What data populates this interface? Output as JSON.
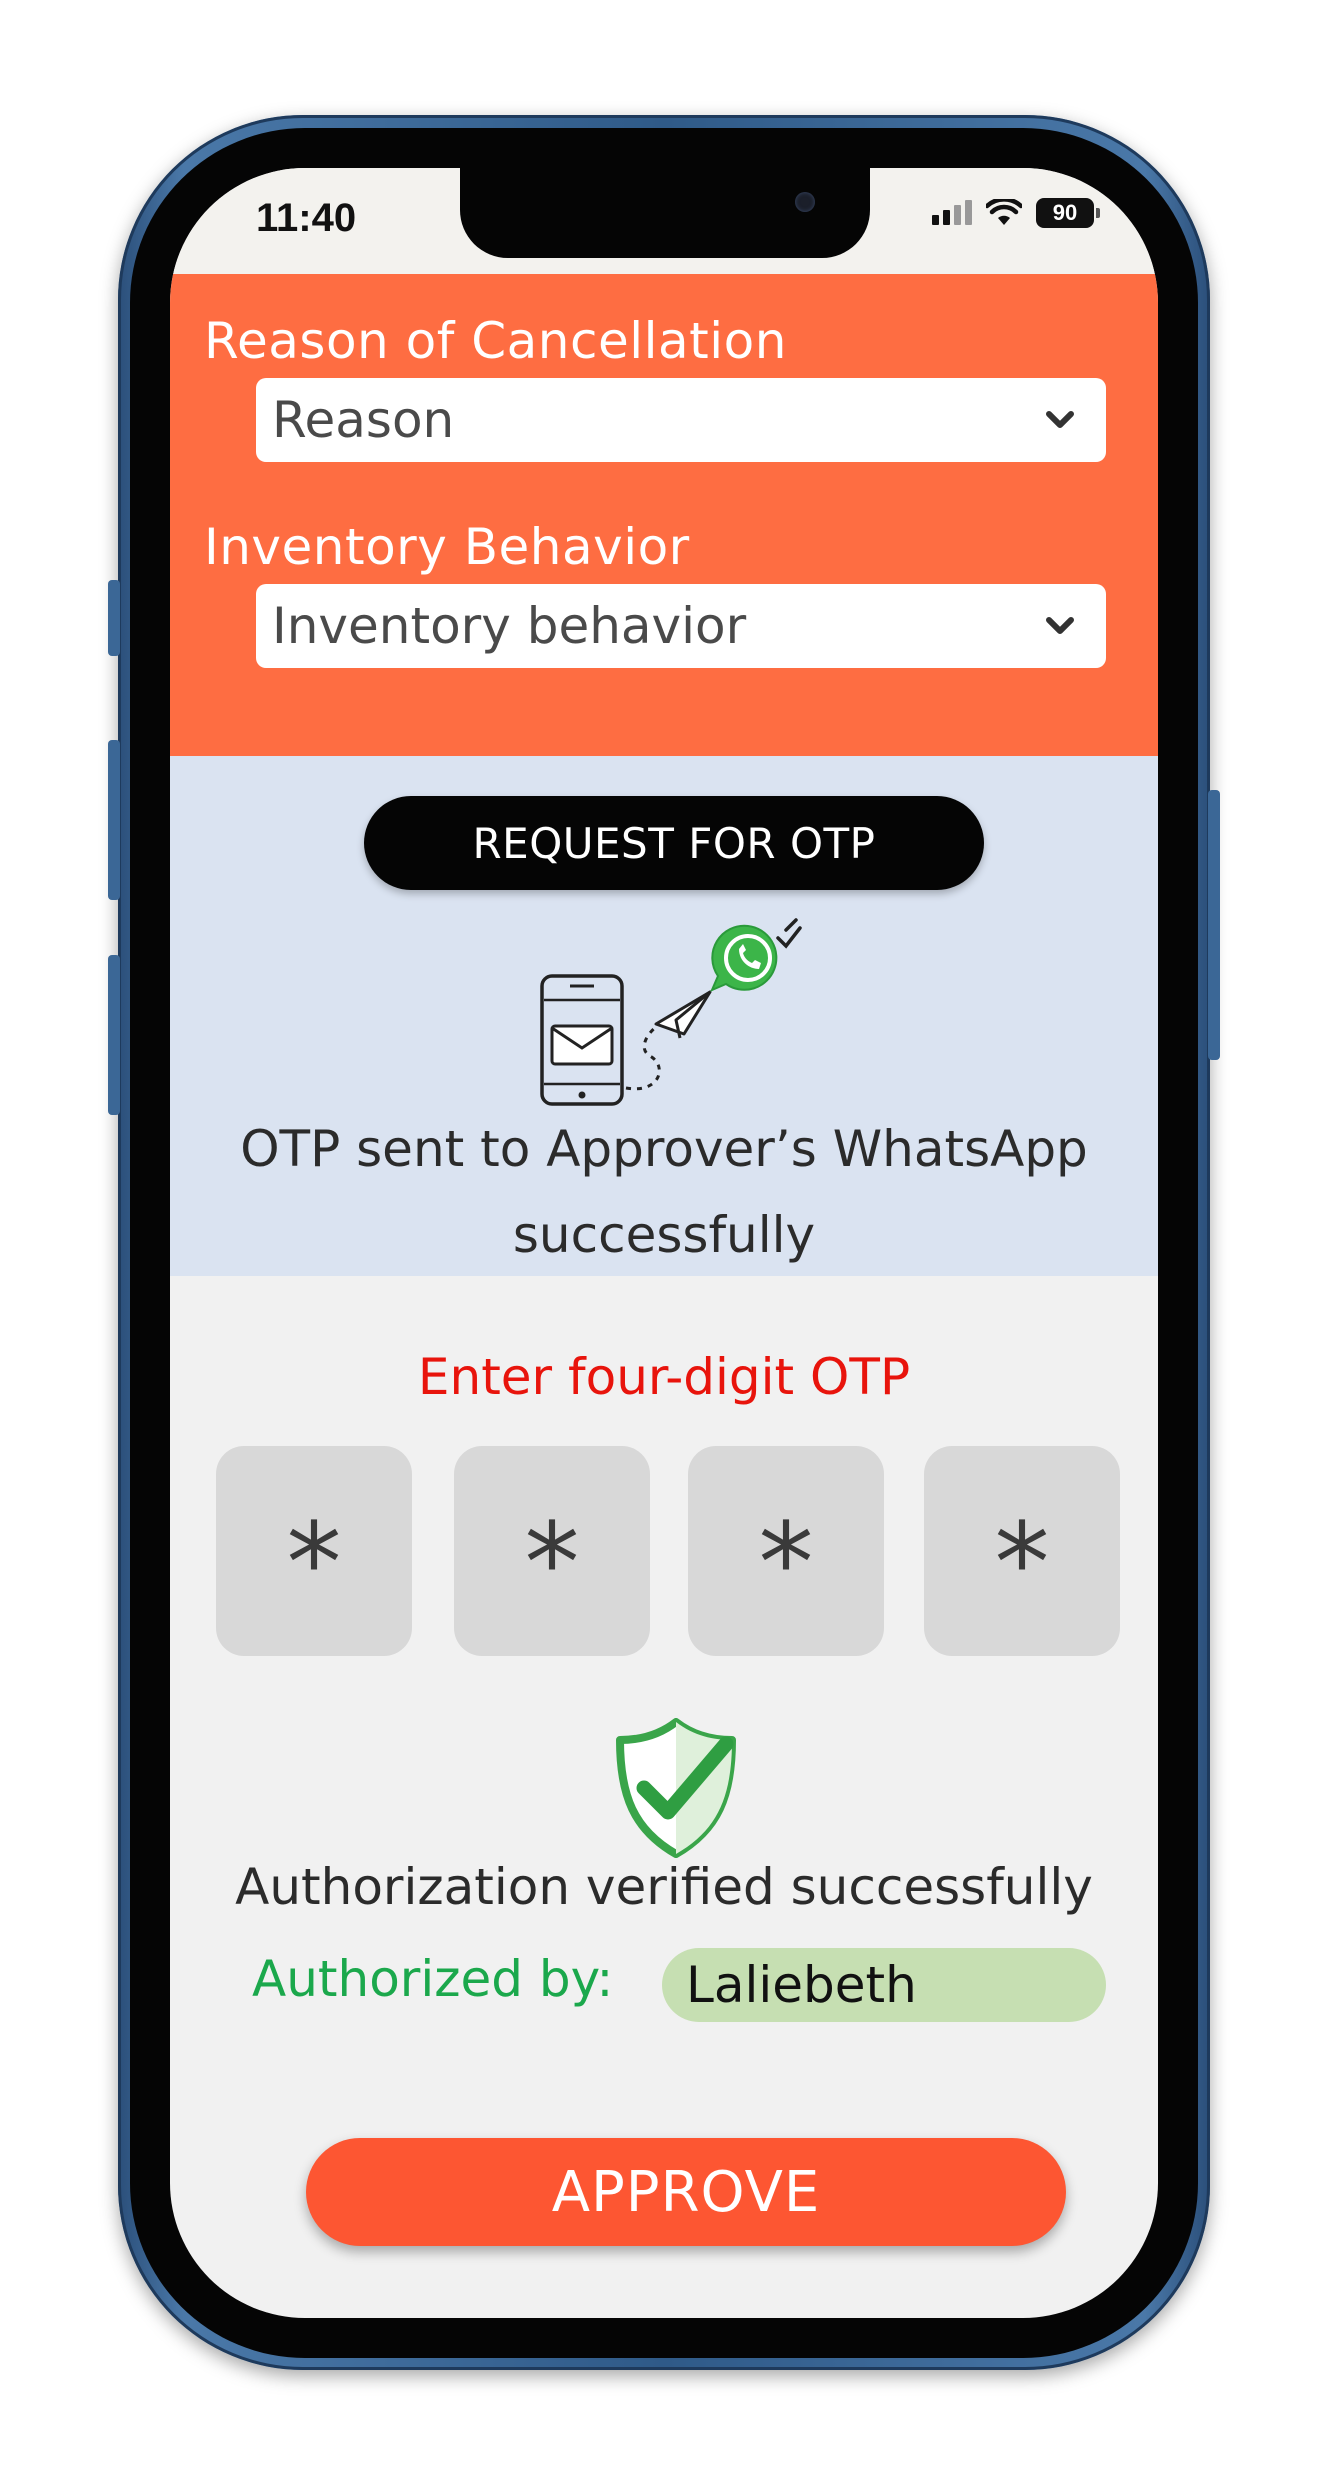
{
  "status_bar": {
    "time": "11:40",
    "battery": "90"
  },
  "form": {
    "reason_label": "Reason of Cancellation",
    "reason_value": "Reason",
    "inventory_label": "Inventory Behavior",
    "inventory_value": "Inventory behavior"
  },
  "otp_request": {
    "button_label": "REQUEST FOR OTP",
    "sent_message_line1": "OTP sent to Approver’s WhatsApp",
    "sent_message_line2": "successfully"
  },
  "otp_entry": {
    "label": "Enter four-digit OTP",
    "digits": [
      "*",
      "*",
      "*",
      "*"
    ]
  },
  "authorization": {
    "verified_text": "Authorization verified successfully",
    "authorized_by_label": "Authorized by:",
    "authorized_by_name": "Laliebeth"
  },
  "actions": {
    "approve_label": "APPROVE"
  },
  "colors": {
    "header_orange": "#fe6d42",
    "otp_panel_blue": "#dae3f1",
    "otp_label_red": "#e8140c",
    "success_green": "#1ba84c",
    "approve_button": "#fd5632",
    "name_pill": "#c6dfb2"
  },
  "icons": [
    "chevron-down-icon",
    "envelope-phone-icon",
    "paper-plane-icon",
    "whatsapp-icon",
    "double-check-icon",
    "shield-check-icon",
    "signal-icon",
    "wifi-icon",
    "battery-icon"
  ]
}
